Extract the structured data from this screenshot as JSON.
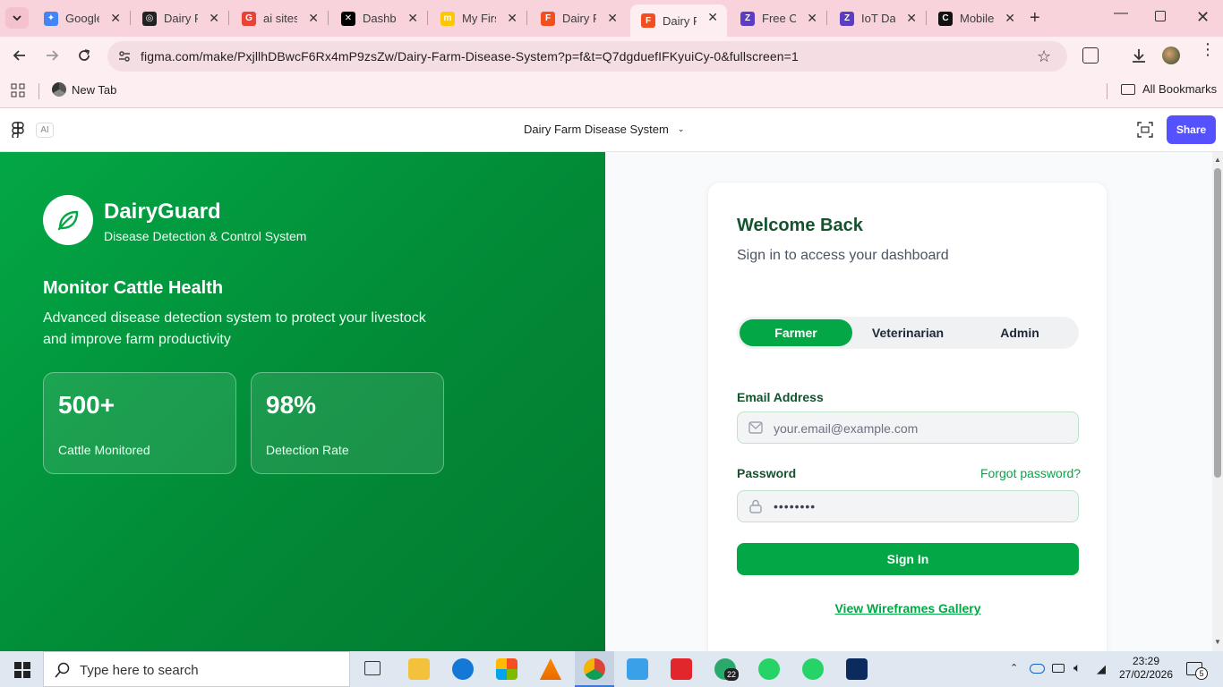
{
  "tabs": [
    {
      "title": "Google",
      "color": "#4285f4",
      "glyph": "✦"
    },
    {
      "title": "Dairy Fa",
      "color": "#222222",
      "glyph": "◎"
    },
    {
      "title": "ai sites",
      "color": "#ea4335",
      "glyph": "G"
    },
    {
      "title": "Dashbo",
      "color": "#000000",
      "glyph": "✕"
    },
    {
      "title": "My First",
      "color": "#ffc700",
      "glyph": "m"
    },
    {
      "title": "Dairy Fa",
      "color": "#f24e1e",
      "glyph": "F"
    },
    {
      "title": "Dairy Fa",
      "color": "#f24e1e",
      "glyph": "F"
    },
    {
      "title": "Free Or",
      "color": "#5b3cc4",
      "glyph": "Z"
    },
    {
      "title": "IoT Dat",
      "color": "#5b3cc4",
      "glyph": "Z"
    },
    {
      "title": "Mobile",
      "color": "#111111",
      "glyph": "C"
    }
  ],
  "browser": {
    "url": "figma.com/make/PxjllhDBwcF6Rx4mP9zsZw/Dairy-Farm-Disease-System?p=f&t=Q7dgduefIFKyuiCy-0&fullscreen=1",
    "bookmark_new_tab": "New Tab",
    "all_bookmarks": "All Bookmarks"
  },
  "figma": {
    "ai_badge": "AI",
    "project_title": "Dairy Farm Disease System",
    "share_label": "Share",
    "accent": "#5551ff"
  },
  "brand": {
    "name": "DairyGuard",
    "tagline": "Disease Detection & Control System",
    "primary": "#03a745"
  },
  "hero": {
    "heading": "Monitor Cattle Health",
    "description_line1": "Advanced disease detection system to protect your livestock",
    "description_line2": "and improve farm productivity"
  },
  "stats": [
    {
      "value": "500+",
      "label": "Cattle Monitored"
    },
    {
      "value": "98%",
      "label": "Detection Rate"
    }
  ],
  "login": {
    "title": "Welcome Back",
    "subtitle": "Sign in to access your dashboard",
    "roles": [
      "Farmer",
      "Veterinarian",
      "Admin"
    ],
    "selected_role": "Farmer",
    "email_label": "Email Address",
    "email_placeholder": "your.email@example.com",
    "password_label": "Password",
    "forgot_label": "Forgot password?",
    "password_value": "••••••••",
    "signin_label": "Sign In",
    "wireframes_link": "View Wireframes Gallery"
  },
  "taskbar": {
    "search_placeholder": "Type here to search",
    "time": "23:29",
    "date": "27/02/2026",
    "whatsapp_badge": "22",
    "notifications": "5"
  }
}
